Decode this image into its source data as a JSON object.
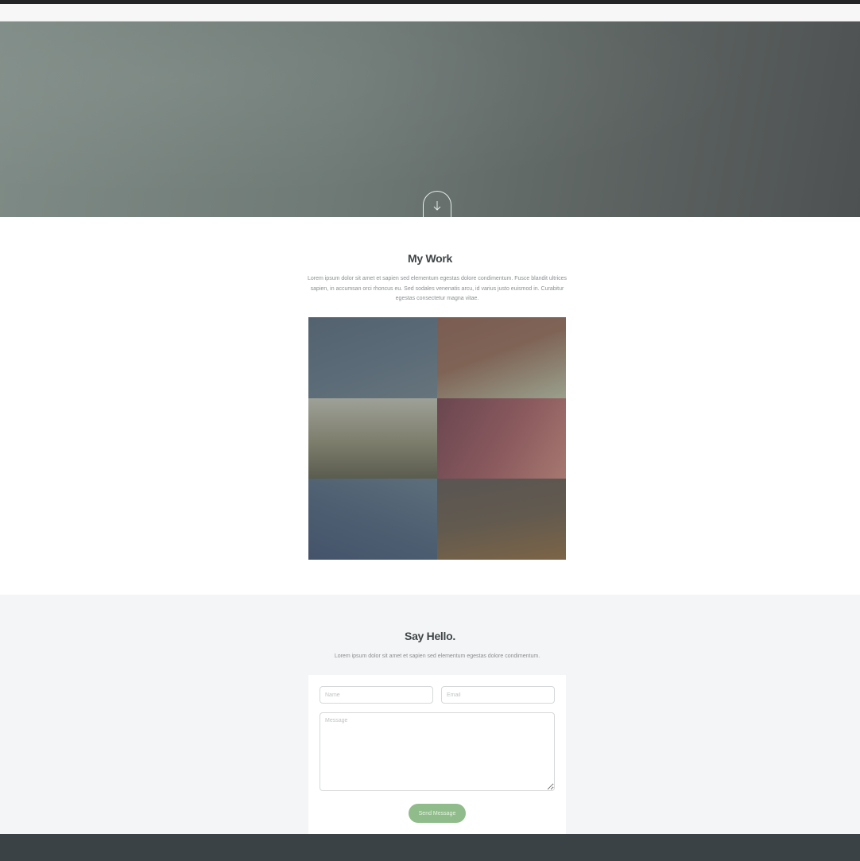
{
  "hero": {
    "scroll_icon": "arrow-down-icon"
  },
  "work": {
    "title": "My Work",
    "description": "Lorem ipsum dolor sit amet et sapien sed elementum egestas dolore condimentum. Fusce blandit ultrices sapien, in accumsan orci rhoncus eu. Sed sodales venenatis arcu, id varius justo euismod in. Curabitur egestas consectetur magna vitae."
  },
  "contact": {
    "title": "Say Hello.",
    "description": "Lorem ipsum dolor sit amet et sapien sed elementum egestas dolore condimentum.",
    "name_placeholder": "Name",
    "email_placeholder": "Email",
    "message_placeholder": "Message",
    "send_label": "Send Message"
  },
  "colors": {
    "accent_button": "#8fbc8a",
    "footer": "#3a4246",
    "topbar": "#222425"
  }
}
